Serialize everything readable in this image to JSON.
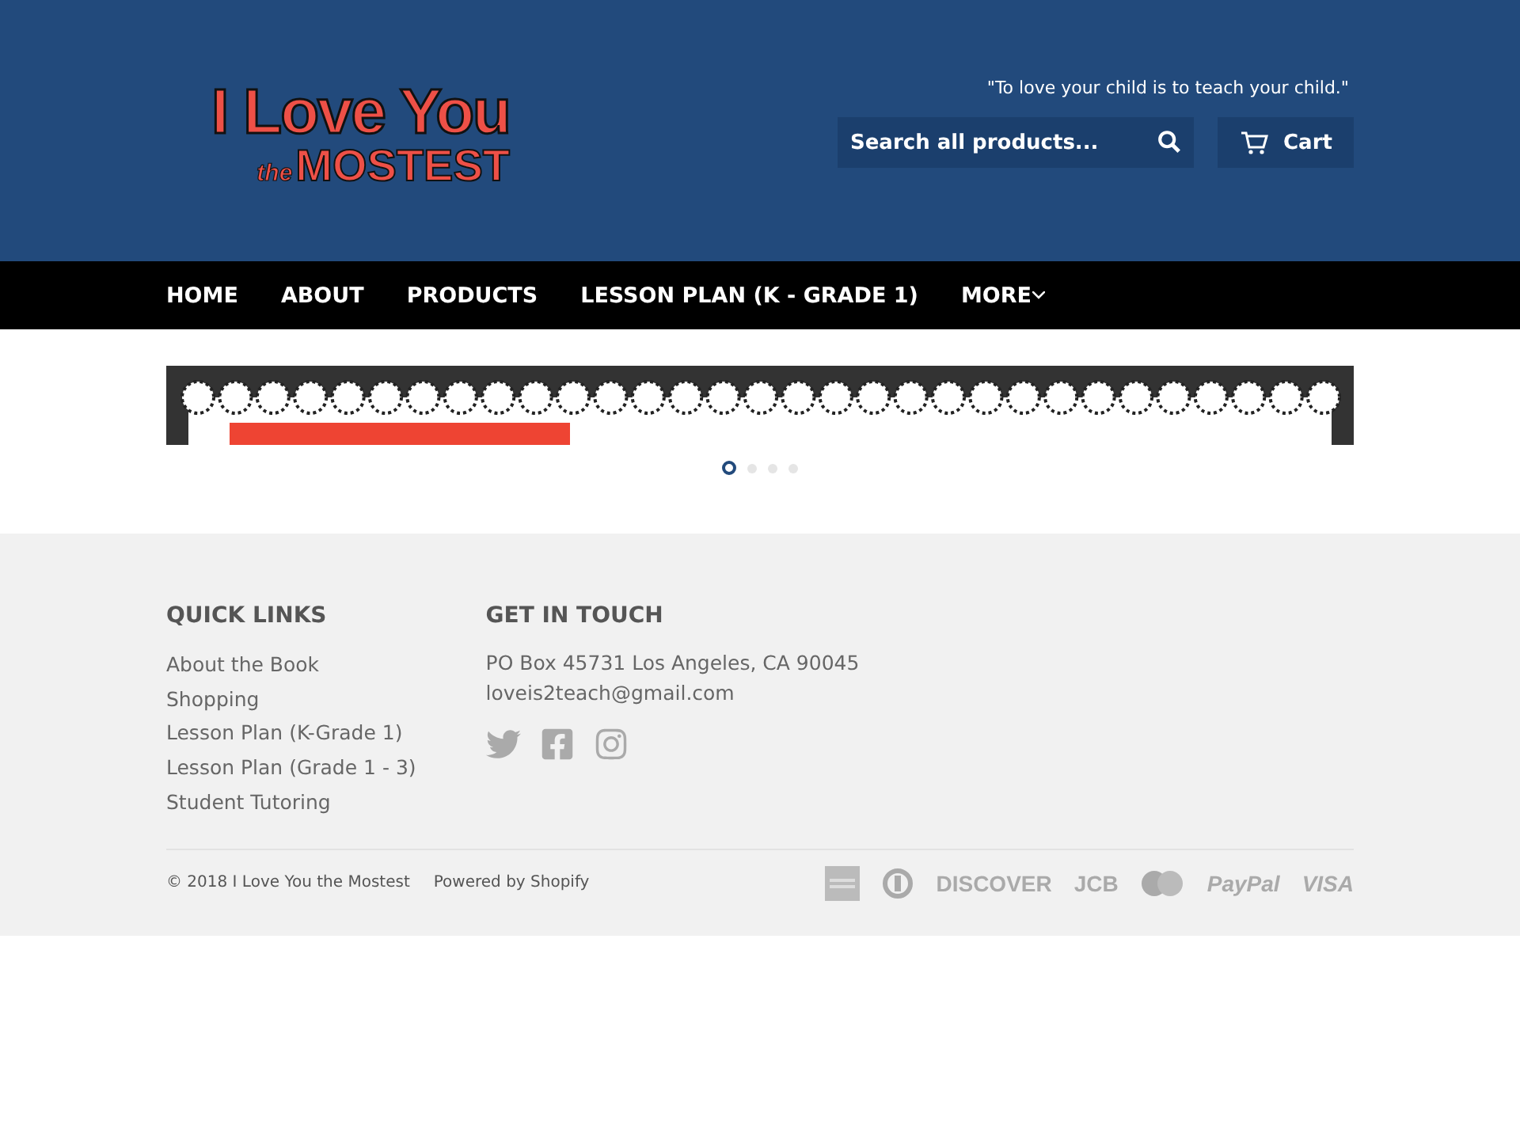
{
  "header": {
    "logo": {
      "line1": "I Love You",
      "line2_small": "the",
      "line2": "MOSTEST"
    },
    "tagline": "\"To love your child is to teach your child.\"",
    "search": {
      "placeholder": "Search all products..."
    },
    "cart": {
      "label": "Cart"
    }
  },
  "nav": [
    {
      "label": "HOME",
      "dropdown": false
    },
    {
      "label": "ABOUT",
      "dropdown": false
    },
    {
      "label": "PRODUCTS",
      "dropdown": false
    },
    {
      "label": "LESSON PLAN (K - GRADE 1)",
      "dropdown": false
    },
    {
      "label": "MORE",
      "dropdown": true
    }
  ],
  "slideshow": {
    "dots": [
      {
        "selected": true
      },
      {
        "selected": false
      },
      {
        "selected": false
      },
      {
        "selected": false
      }
    ]
  },
  "footer": {
    "quick_links": {
      "title": "QUICK LINKS",
      "items": [
        "About the Book",
        "Shopping",
        "Lesson Plan (K-Grade 1)",
        "Lesson Plan (Grade 1 - 3)",
        "Student Tutoring"
      ]
    },
    "contact": {
      "title": "GET IN TOUCH",
      "address": "PO Box 45731 Los Angeles, CA 90045",
      "email": "loveis2teach@gmail.com",
      "social": [
        {
          "kind": "twitter"
        },
        {
          "kind": "facebook"
        },
        {
          "kind": "instagram"
        }
      ]
    },
    "copyright": "© 2018 I Love You the Mostest",
    "powered": "Powered by Shopify",
    "payments": [
      {
        "kind": "amex"
      },
      {
        "kind": "diners"
      },
      {
        "kind": "text",
        "label": "DISCOVER"
      },
      {
        "kind": "text",
        "label": "JCB"
      },
      {
        "kind": "mastercard"
      },
      {
        "kind": "italic",
        "label": "PayPal"
      },
      {
        "kind": "italic",
        "label": "VISA"
      }
    ]
  }
}
